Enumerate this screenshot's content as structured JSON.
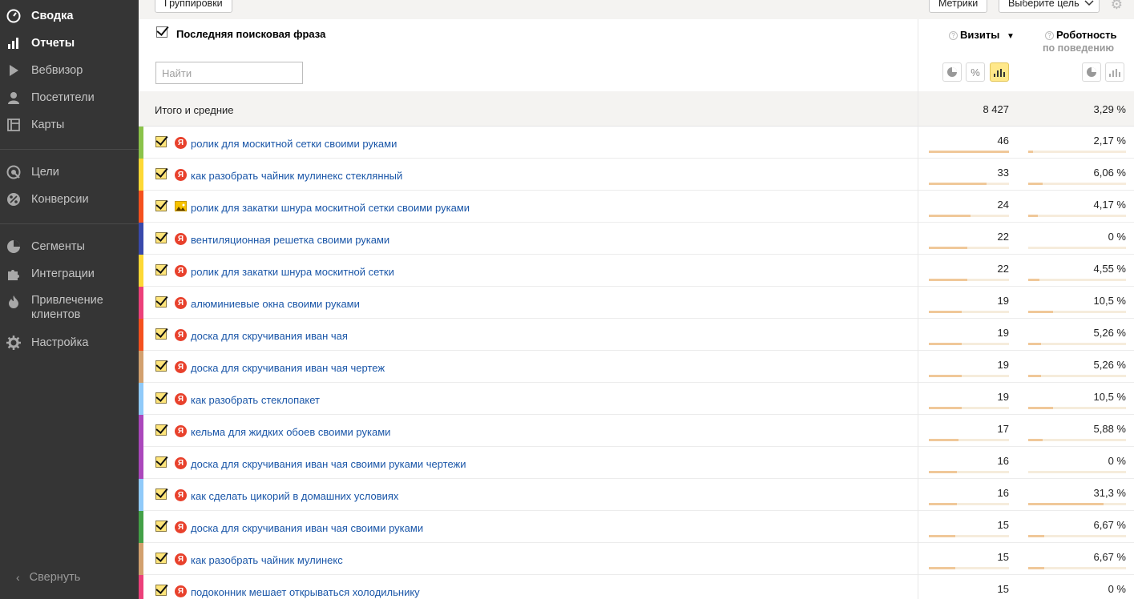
{
  "sidebar": {
    "items": [
      {
        "label": "Сводка",
        "icon": "dashboard-icon",
        "active": true
      },
      {
        "label": "Отчеты",
        "icon": "bar-chart-icon",
        "active": true
      },
      {
        "label": "Вебвизор",
        "icon": "play-icon",
        "active": false
      },
      {
        "label": "Посетители",
        "icon": "user-icon",
        "active": false
      },
      {
        "label": "Карты",
        "icon": "map-layout-icon",
        "active": false
      },
      {
        "label": "Цели",
        "icon": "target-icon",
        "active": false
      },
      {
        "label": "Конверсии",
        "icon": "percent-icon",
        "active": false
      },
      {
        "label": "Сегменты",
        "icon": "pie-icon",
        "active": false
      },
      {
        "label": "Интеграции",
        "icon": "puzzle-icon",
        "active": false
      },
      {
        "label": "Привлечение клиентов",
        "icon": "flame-icon",
        "active": false
      },
      {
        "label": "Настройка",
        "icon": "gear-icon",
        "active": false
      }
    ],
    "collapse_label": "Свернуть"
  },
  "toolbar": {
    "groupings_label": "Группировки",
    "metrics_label": "Метрики",
    "goal_select_label": "Выберите цель"
  },
  "header": {
    "dimension_title": "Последняя поисковая фраза",
    "search_placeholder": "Найти",
    "col_visits": "Визиты",
    "col_visits_sort": "▼",
    "col_robot": "Роботность",
    "col_robot_sub": "по поведению"
  },
  "totals": {
    "label": "Итого и средние",
    "visits": "8 427",
    "robot": "3,29 %"
  },
  "rows": [
    {
      "phrase": "ролик для москитной сетки своими руками",
      "visits": "46",
      "robot": "2,17 %",
      "visits_frac": 1.0,
      "robot_frac": 0.069,
      "color": "#8bc34a",
      "icon": "yandex"
    },
    {
      "phrase": "как разобрать чайник мулинекс стеклянный",
      "visits": "33",
      "robot": "6,06 %",
      "visits_frac": 0.72,
      "robot_frac": 0.19,
      "color": "#fdd835",
      "icon": "yandex"
    },
    {
      "phrase": "ролик для закатки шнура москитной сетки своими руками",
      "visits": "24",
      "robot": "4,17 %",
      "visits_frac": 0.52,
      "robot_frac": 0.13,
      "color": "#f4511e",
      "icon": "image"
    },
    {
      "phrase": "вентиляционная решетка своими руками",
      "visits": "22",
      "robot": "0 %",
      "visits_frac": 0.48,
      "robot_frac": 0.0,
      "color": "#3949ab",
      "icon": "yandex"
    },
    {
      "phrase": "ролик для закатки шнура москитной сетки",
      "visits": "22",
      "robot": "4,55 %",
      "visits_frac": 0.48,
      "robot_frac": 0.145,
      "color": "#fdd835",
      "icon": "yandex"
    },
    {
      "phrase": "алюминиевые окна своими руками",
      "visits": "19",
      "robot": "10,5 %",
      "visits_frac": 0.41,
      "robot_frac": 0.335,
      "color": "#ec407a",
      "icon": "yandex"
    },
    {
      "phrase": "доска для скручивания иван чая",
      "visits": "19",
      "robot": "5,26 %",
      "visits_frac": 0.41,
      "robot_frac": 0.168,
      "color": "#f4511e",
      "icon": "yandex"
    },
    {
      "phrase": "доска для скручивания иван чая чертеж",
      "visits": "19",
      "robot": "5,26 %",
      "visits_frac": 0.41,
      "robot_frac": 0.168,
      "color": "#d2a06e",
      "icon": "yandex"
    },
    {
      "phrase": "как разобрать стеклопакет",
      "visits": "19",
      "robot": "10,5 %",
      "visits_frac": 0.41,
      "robot_frac": 0.335,
      "color": "#90caf9",
      "icon": "yandex"
    },
    {
      "phrase": "кельма для жидких обоев своими руками",
      "visits": "17",
      "robot": "5,88 %",
      "visits_frac": 0.37,
      "robot_frac": 0.188,
      "color": "#ab47bc",
      "icon": "yandex"
    },
    {
      "phrase": "доска для скручивания иван чая своими руками чертежи",
      "visits": "16",
      "robot": "0 %",
      "visits_frac": 0.35,
      "robot_frac": 0.0,
      "color": "#ab47bc",
      "icon": "yandex"
    },
    {
      "phrase": "как сделать цикорий в домашних условиях",
      "visits": "16",
      "robot": "31,3 %",
      "visits_frac": 0.35,
      "robot_frac": 1.0,
      "color": "#90caf9",
      "icon": "yandex"
    },
    {
      "phrase": "доска для скручивания иван чая своими руками",
      "visits": "15",
      "robot": "6,67 %",
      "visits_frac": 0.33,
      "robot_frac": 0.213,
      "color": "#43a047",
      "icon": "yandex"
    },
    {
      "phrase": "как разобрать чайник мулинекс",
      "visits": "15",
      "robot": "6,67 %",
      "visits_frac": 0.33,
      "robot_frac": 0.213,
      "color": "#d2a06e",
      "icon": "yandex"
    },
    {
      "phrase": "подоконник мешает открываться холодильнику",
      "visits": "15",
      "robot": "0 %",
      "visits_frac": 0.33,
      "robot_frac": 0.0,
      "color": "#ec407a",
      "icon": "yandex"
    }
  ]
}
